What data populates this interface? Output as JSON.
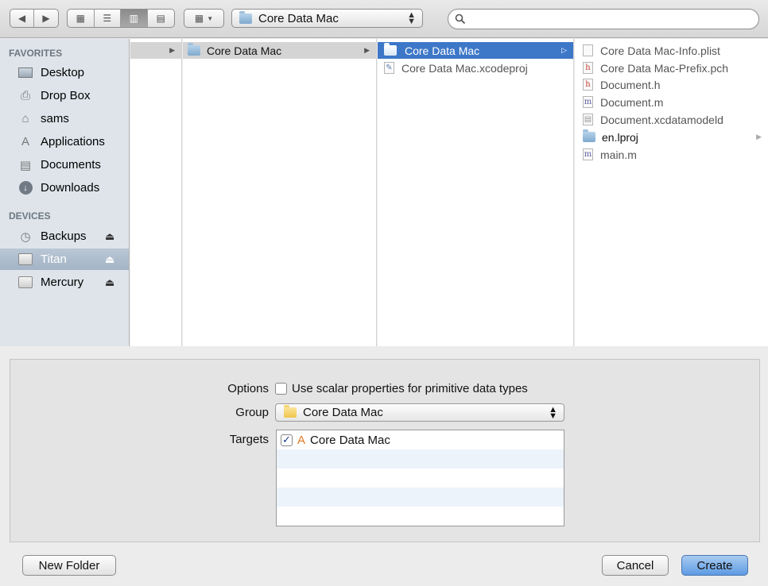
{
  "toolbar": {
    "path_popup_label": "Core Data Mac",
    "search_placeholder": ""
  },
  "sidebar": {
    "favorites_header": "FAVORITES",
    "favorites": [
      {
        "label": "Desktop",
        "icon": "desktop-icon"
      },
      {
        "label": "Drop Box",
        "icon": "drop-box-icon"
      },
      {
        "label": "sams",
        "icon": "home-icon"
      },
      {
        "label": "Applications",
        "icon": "applications-icon"
      },
      {
        "label": "Documents",
        "icon": "documents-icon"
      },
      {
        "label": "Downloads",
        "icon": "downloads-icon"
      }
    ],
    "devices_header": "DEVICES",
    "devices": [
      {
        "label": "Backups",
        "icon": "time-machine-icon",
        "ejectable": true,
        "selected": false
      },
      {
        "label": "Titan",
        "icon": "disk-icon",
        "ejectable": true,
        "selected": true
      },
      {
        "label": "Mercury",
        "icon": "disk-icon",
        "ejectable": true,
        "selected": false
      }
    ]
  },
  "columns": {
    "col2": [
      {
        "label": "Core Data Mac",
        "type": "folder"
      }
    ],
    "col3": [
      {
        "label": "Core Data Mac",
        "type": "folder",
        "selected": true
      },
      {
        "label": "Core Data Mac.xcodeproj",
        "type": "xcodeproj"
      }
    ],
    "col4": [
      {
        "label": "Core Data Mac-Info.plist",
        "type": "plist"
      },
      {
        "label": "Core Data Mac-Prefix.pch",
        "type": "h"
      },
      {
        "label": "Document.h",
        "type": "h"
      },
      {
        "label": "Document.m",
        "type": "m"
      },
      {
        "label": "Document.xcdatamodeld",
        "type": "model"
      },
      {
        "label": "en.lproj",
        "type": "folder"
      },
      {
        "label": "main.m",
        "type": "m"
      }
    ]
  },
  "options": {
    "options_label": "Options",
    "scalar_checkbox_label": "Use scalar properties for primitive data types",
    "scalar_checked": false,
    "group_label": "Group",
    "group_value": "Core Data Mac",
    "targets_label": "Targets",
    "targets": [
      {
        "label": "Core Data Mac",
        "checked": true
      }
    ]
  },
  "buttons": {
    "new_folder": "New Folder",
    "cancel": "Cancel",
    "create": "Create"
  }
}
